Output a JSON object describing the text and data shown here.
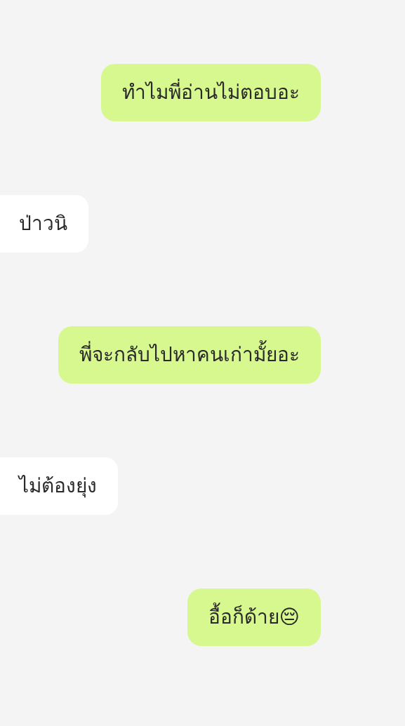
{
  "messages": [
    {
      "kind": "sent",
      "text": "ทำไมพี่อ่านไม่ตอบอะ"
    },
    {
      "kind": "received",
      "text": "ป่าวนิ"
    },
    {
      "kind": "sent",
      "text": "พี่จะกลับไปหาคนเก่ามั้ยอะ"
    },
    {
      "kind": "received",
      "text": "ไม่ต้องยุ่ง"
    },
    {
      "kind": "sent",
      "text": "อื้อก็ด้าย😔"
    }
  ]
}
